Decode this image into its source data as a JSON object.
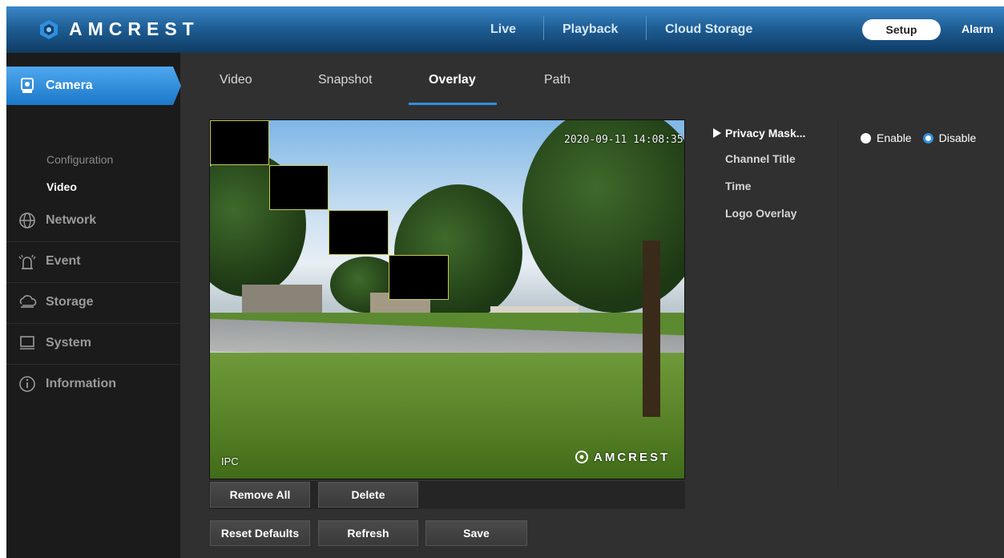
{
  "brand": {
    "name": "AMCREST"
  },
  "topnav": {
    "live": "Live",
    "playback": "Playback",
    "cloud_storage": "Cloud Storage",
    "setup": "Setup",
    "alarm": "Alarm"
  },
  "sidebar": {
    "camera": "Camera",
    "sub_items": [
      "Configuration",
      "Video"
    ],
    "network": "Network",
    "event": "Event",
    "storage": "Storage",
    "system": "System",
    "information": "Information"
  },
  "tabs": [
    "Video",
    "Snapshot",
    "Overlay",
    "Path"
  ],
  "active_tab": "Overlay",
  "video": {
    "timestamp": "2020-09-11 14:08:35",
    "channel_label": "IPC",
    "watermark": "AMCREST"
  },
  "buttons": {
    "remove_all": "Remove All",
    "delete": "Delete",
    "reset_defaults": "Reset Defaults",
    "refresh": "Refresh",
    "save": "Save"
  },
  "overlay_menu": {
    "items": [
      "Privacy Mask...",
      "Channel Title",
      "Time",
      "Logo Overlay"
    ],
    "active": "Privacy Mask..."
  },
  "privacy_mask": {
    "enable_label": "Enable",
    "disable_label": "Disable",
    "selected": "Disable"
  },
  "colors": {
    "accent": "#2f8fe0",
    "topbar": "#1f5f96",
    "sidebar_bg": "#1b1b1b",
    "content_bg": "#303030"
  }
}
